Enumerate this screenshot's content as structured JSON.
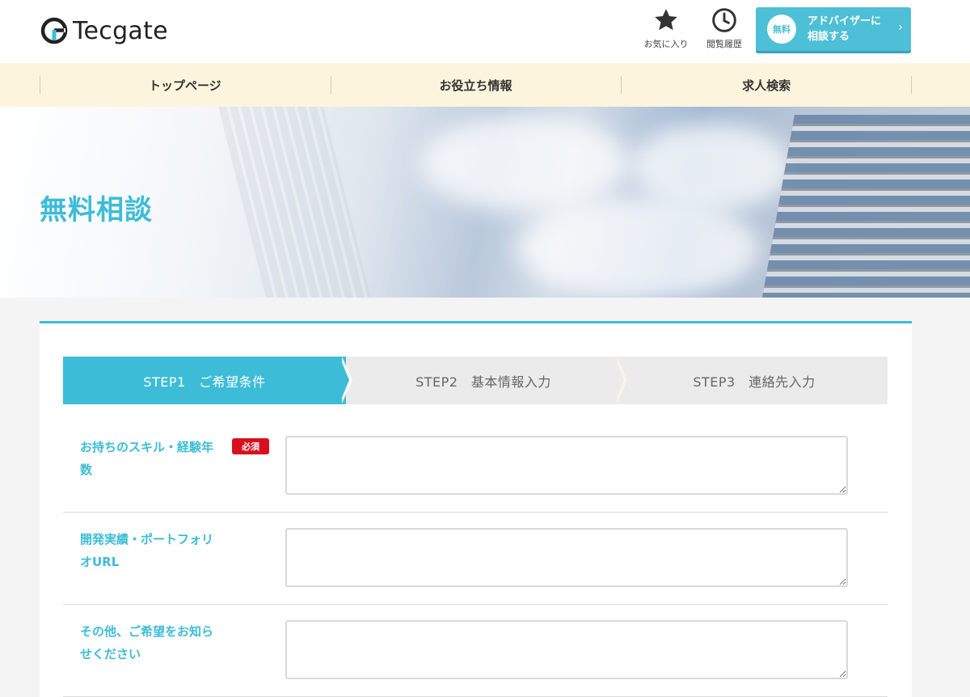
{
  "header": {
    "logo_text": "Tecgate",
    "favorites_label": "お気に入り",
    "history_label": "閲覧履歴",
    "advisor_badge": "無料",
    "advisor_line1": "アドバイザーに",
    "advisor_line2": "相談する"
  },
  "nav": {
    "items": [
      {
        "label": "トップページ"
      },
      {
        "label": "お役立ち情報"
      },
      {
        "label": "求人検索"
      }
    ]
  },
  "hero": {
    "title": "無料相談"
  },
  "steps": [
    {
      "label": "STEP1　ご希望条件",
      "active": true
    },
    {
      "label": "STEP2　基本情報入力",
      "active": false
    },
    {
      "label": "STEP3　連絡先入力",
      "active": false
    }
  ],
  "form": {
    "fields": [
      {
        "label_line1": "お持ちのスキル・経験年",
        "label_line2": "数",
        "required_badge": "必須",
        "value": ""
      },
      {
        "label_line1": "開発実績・ポートフォリ",
        "label_line2": "オURL",
        "value": ""
      },
      {
        "label_line1": "その他、ご希望をお知ら",
        "label_line2": "せください",
        "value": ""
      }
    ]
  },
  "colors": {
    "accent": "#3dbcd8",
    "advisor_button": "#4dbfd6",
    "nav_bg": "#fdf4dd",
    "required": "#d8101e"
  },
  "icons": [
    "logo-mark-icon",
    "star-icon",
    "clock-icon",
    "chevron-right-icon"
  ]
}
